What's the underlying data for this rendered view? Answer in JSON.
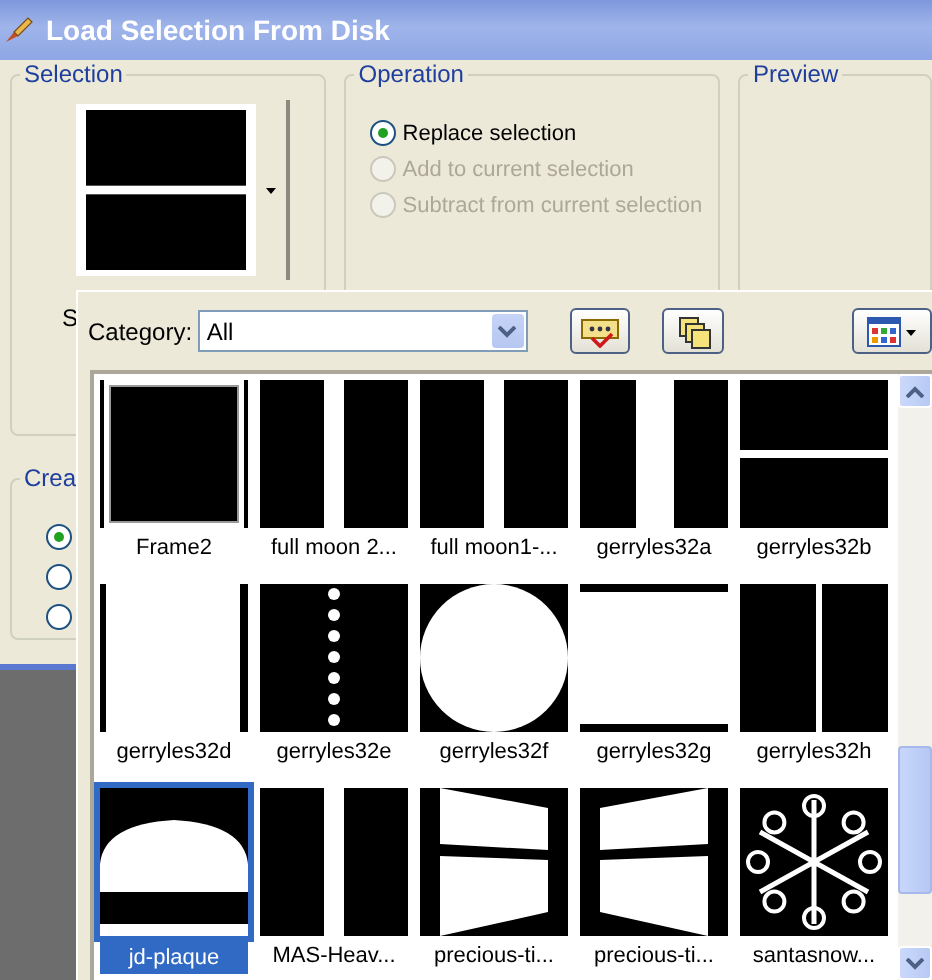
{
  "window": {
    "title": "Load Selection From Disk"
  },
  "selection_group": {
    "label": "Selection",
    "preview": {
      "kind": "rows"
    },
    "cut_label": "S"
  },
  "operation_group": {
    "label": "Operation",
    "options": [
      {
        "label": "Replace selection",
        "selected": true,
        "disabled": false
      },
      {
        "label": "Add to current selection",
        "selected": false,
        "disabled": true
      },
      {
        "label": "Subtract from current selection",
        "selected": false,
        "disabled": true
      }
    ]
  },
  "preview_group": {
    "label": "Preview"
  },
  "creation_group": {
    "label": "Crea",
    "options": [
      {
        "selected": true
      },
      {
        "selected": false
      },
      {
        "selected": false
      }
    ]
  },
  "picker": {
    "category_label": "Category:",
    "category_value": "All",
    "items": [
      {
        "name": "Frame2",
        "kind": "frame",
        "selected": false
      },
      {
        "name": "full moon 2...",
        "kind": "columns",
        "selected": false
      },
      {
        "name": "full moon1-...",
        "kind": "columns",
        "selected": false
      },
      {
        "name": "gerryles32a",
        "kind": "wide-columns",
        "selected": false
      },
      {
        "name": "gerryles32b",
        "kind": "rows",
        "selected": false
      },
      {
        "name": "gerryles32d",
        "kind": "side-bars",
        "selected": false
      },
      {
        "name": "gerryles32e",
        "kind": "dotted-line",
        "selected": false
      },
      {
        "name": "gerryles32f",
        "kind": "circle",
        "selected": false
      },
      {
        "name": "gerryles32g",
        "kind": "top-bottom-bars",
        "selected": false
      },
      {
        "name": "gerryles32h",
        "kind": "thin-line",
        "selected": false
      },
      {
        "name": "jd-plaque",
        "kind": "dome",
        "selected": true
      },
      {
        "name": "MAS-Heav...",
        "kind": "columns",
        "selected": false
      },
      {
        "name": "precious-ti...",
        "kind": "skew-left",
        "selected": false
      },
      {
        "name": "precious-ti...",
        "kind": "skew-right",
        "selected": false
      },
      {
        "name": "santasnow...",
        "kind": "snowflake",
        "selected": false
      }
    ]
  }
}
